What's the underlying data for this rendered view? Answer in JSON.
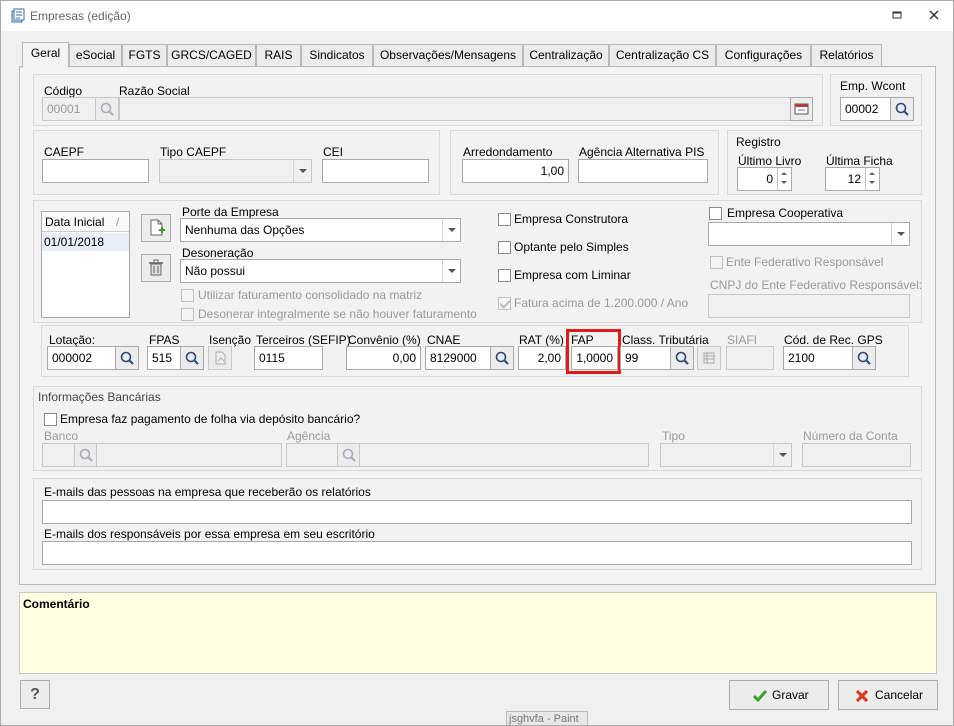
{
  "window": {
    "title": "Empresas (edição)"
  },
  "tabs": [
    "Geral",
    "eSocial",
    "FGTS",
    "GRCS/CAGED",
    "RAIS",
    "Sindicatos",
    "Observações/Mensagens",
    "Centralização",
    "Centralização CS",
    "Configurações",
    "Relatórios"
  ],
  "ident": {
    "codigo_label": "Código",
    "codigo_value": "00001",
    "razao_label": "Razão Social",
    "razao_value": "",
    "emp_wcont_label": "Emp. Wcont",
    "emp_wcont_value": "00002"
  },
  "caepf": {
    "caepf_label": "CAEPF",
    "tipo_label": "Tipo CAEPF",
    "cei_label": "CEI",
    "arred_label": "Arredondamento",
    "arred_value": "1,00",
    "agencia_pis_label": "Agência Alternativa PIS",
    "registro_label": "Registro",
    "ultimo_livro_label": "Último Livro",
    "ultimo_livro_value": "0",
    "ultima_ficha_label": "Última Ficha",
    "ultima_ficha_value": "12"
  },
  "porte": {
    "grid_header": "Data Inicial",
    "grid_row": "01/01/2018",
    "porte_label": "Porte da Empresa",
    "porte_value": "Nenhuma das Opções",
    "desoneracao_label": "Desoneração",
    "desoneracao_value": "Não possui",
    "utilizar_fat": "Utilizar faturamento consolidado na matriz",
    "desonerar_int": "Desonerar integralmente se não houver faturamento",
    "construtora": "Empresa Construtora",
    "optante_simples": "Optante pelo Simples",
    "liminar": "Empresa com Liminar",
    "fatura_acima": "Fatura acima de 1.200.000 / Ano",
    "cooperativa": "Empresa Cooperativa",
    "ente_federativo": "Ente Federativo Responsável",
    "cnpj_ente": "CNPJ do Ente Federativo Responsável:"
  },
  "lotacao": {
    "lotacao_label": "Lotação:",
    "lotacao_value": "000002",
    "fpas_label": "FPAS",
    "fpas_value": "515",
    "isencao_label": "Isenção",
    "terceiros_label": "Terceiros (SEFIP)",
    "terceiros_value": "0115",
    "convenio_label": "Convênio (%)",
    "convenio_value": "0,00",
    "cnae_label": "CNAE",
    "cnae_value": "8129000",
    "rat_label": "RAT (%)",
    "rat_value": "2,00",
    "fap_label": "FAP",
    "fap_value": "1,0000",
    "class_trib_label": "Class. Tributária",
    "class_trib_value": "99",
    "siafi_label": "SIAFI",
    "cod_rec_gps_label": "Cód. de Rec. GPS",
    "cod_rec_gps_value": "2100"
  },
  "bancarias": {
    "title": "Informações Bancárias",
    "pagamento": "Empresa faz pagamento de folha via depósito bancário?",
    "banco_label": "Banco",
    "agencia_label": "Agência",
    "tipo_label": "Tipo",
    "numero_conta_label": "Número da Conta"
  },
  "emails": {
    "pessoas_label": "E-mails das pessoas na empresa que receberão os relatórios",
    "responsaveis_label": "E-mails dos responsáveis por essa empresa em seu escritório"
  },
  "comentario": {
    "label": "Comentário"
  },
  "footer": {
    "help": "?",
    "gravar": "Gravar",
    "cancelar": "Cancelar",
    "tooltip": "jsghvfa - Paint"
  },
  "colors": {
    "comment_bg": "#ffffe1",
    "highlight": "#e21a1a"
  }
}
